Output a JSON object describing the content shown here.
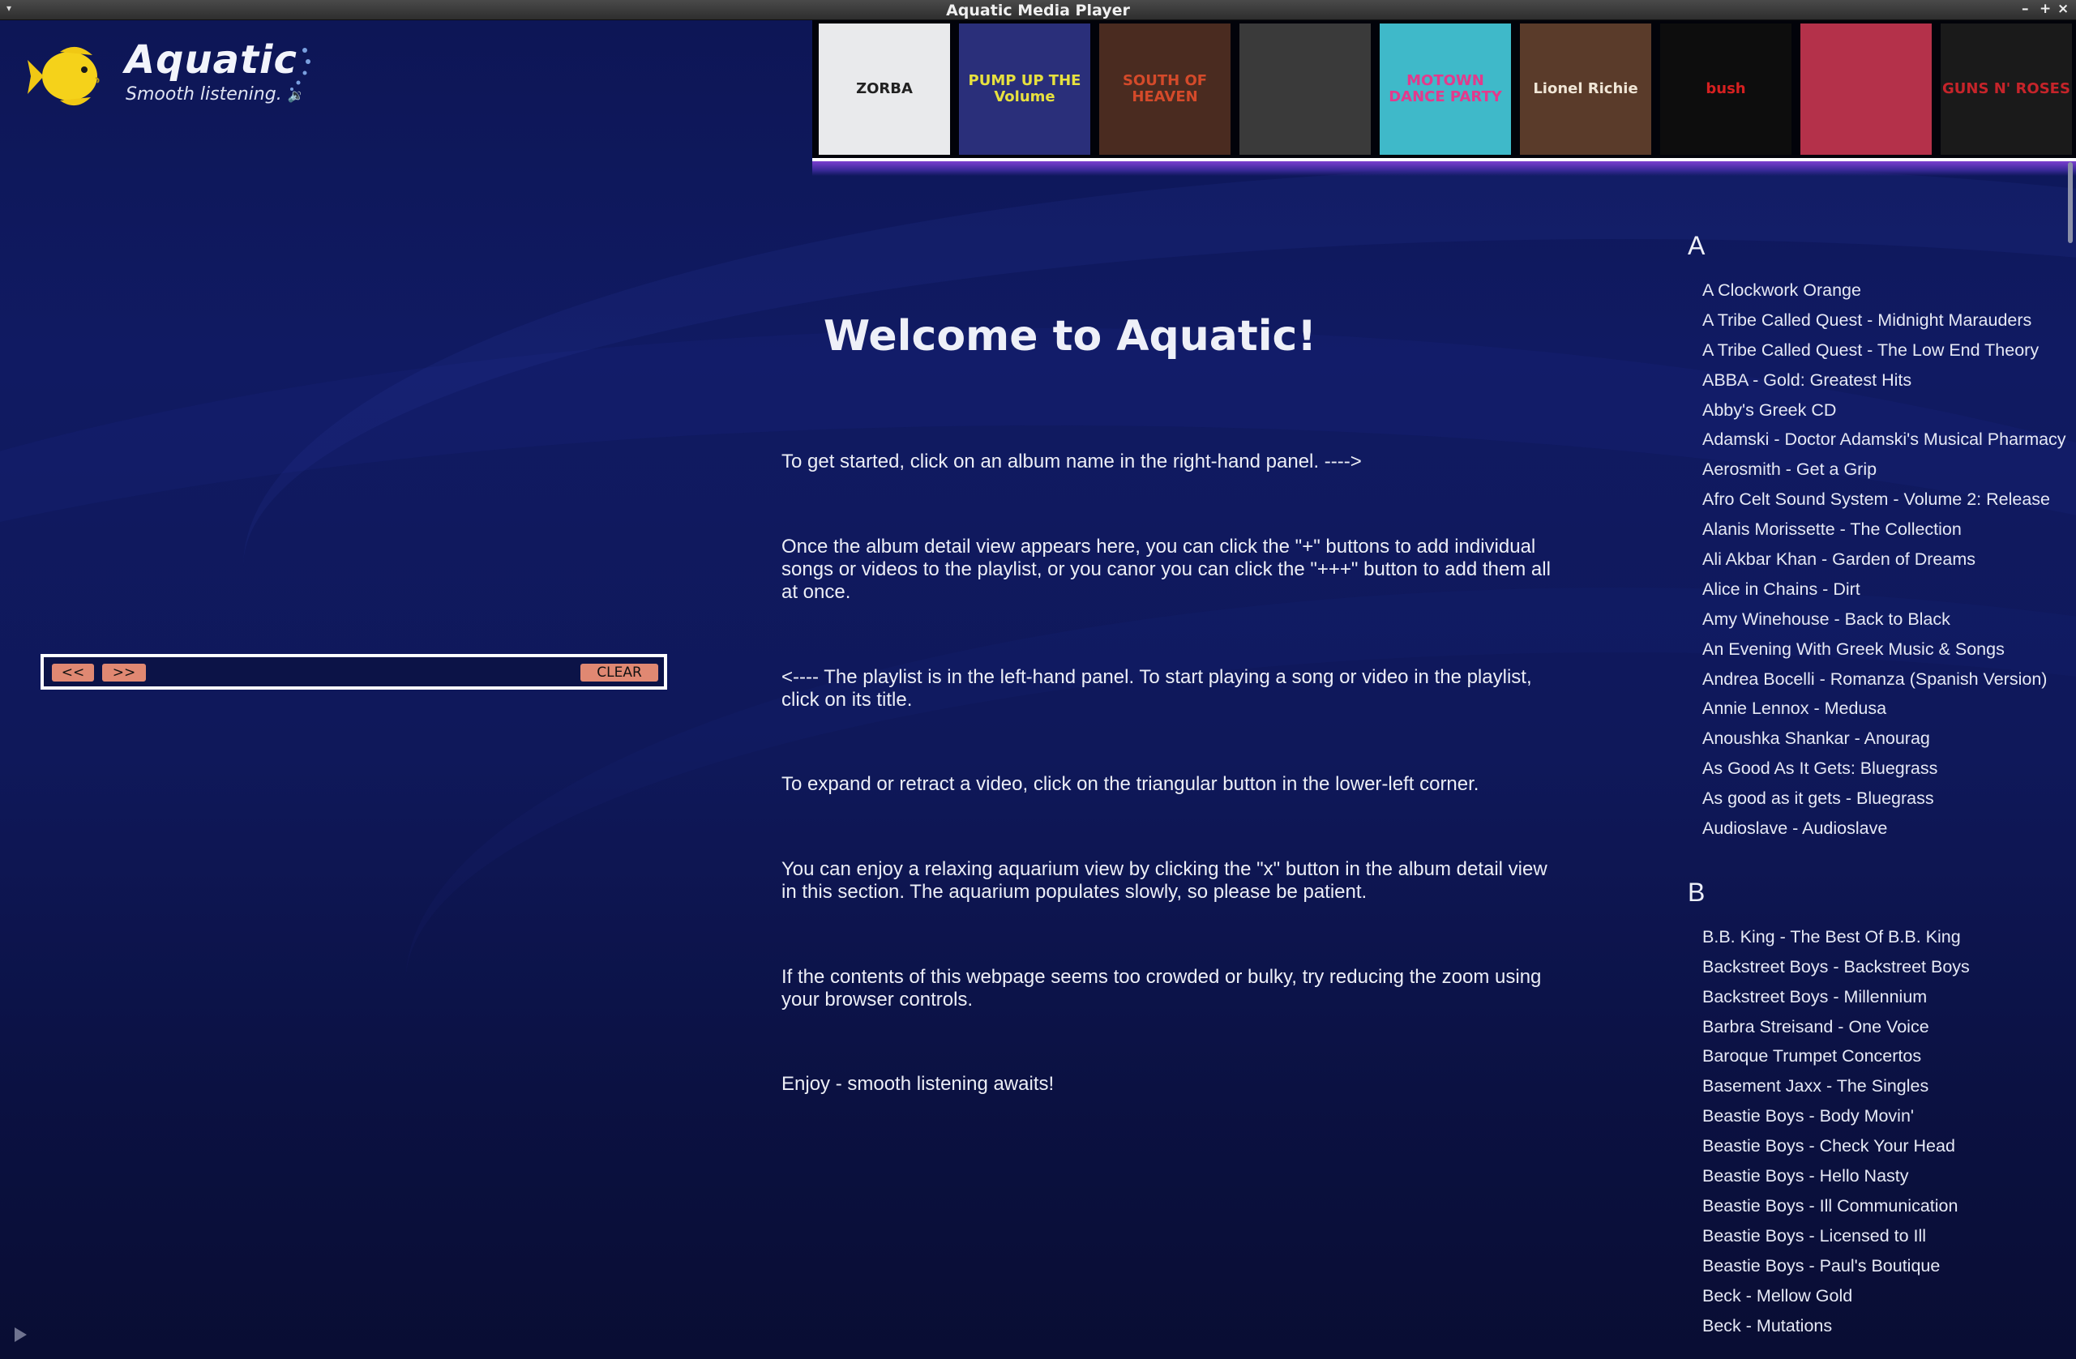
{
  "window": {
    "title": "Aquatic Media Player",
    "controls": {
      "minimize": "–",
      "maximize": "+",
      "close": "×"
    }
  },
  "logo": {
    "app_name": "Aquatic",
    "tagline": "Smooth listening."
  },
  "album_strip": [
    {
      "label": "ZORBA",
      "bg": "#e9eaec",
      "fg": "#222"
    },
    {
      "label": "PUMP UP THE Volume",
      "bg": "#2a2f7a",
      "fg": "#e7e13f"
    },
    {
      "label": "SOUTH OF HEAVEN",
      "bg": "#4a2b20",
      "fg": "#d44a2a"
    },
    {
      "label": "",
      "bg": "#3a3a3a",
      "fg": "#bbb"
    },
    {
      "label": "MOTOWN DANCE PARTY",
      "bg": "#3fb9c9",
      "fg": "#e33a8c"
    },
    {
      "label": "Lionel Richie",
      "bg": "#5a3b2a",
      "fg": "#f0e6d6"
    },
    {
      "label": "bush",
      "bg": "#0d0d0d",
      "fg": "#d62020"
    },
    {
      "label": "",
      "bg": "#b4314a",
      "fg": "#eee"
    },
    {
      "label": "GUNS N' ROSES",
      "bg": "#1a1a1a",
      "fg": "#c6242a"
    }
  ],
  "playlist": {
    "prev_label": "<<",
    "next_label": ">>",
    "clear_label": "CLEAR"
  },
  "main": {
    "title": "Welcome to Aquatic!",
    "paragraphs": [
      "To get started, click on an album name in the right-hand panel.    ---->",
      "Once the album detail view appears here, you can click the \"+\" buttons to add individual songs or videos to the playlist, or you canor you can click the \"+++\" button to add them all at once.",
      "<----    The playlist is in the left-hand panel. To start playing a song or video in the playlist, click on its title.",
      "To expand or retract a video, click on the triangular button in the lower-left corner.",
      "You can enjoy a relaxing aquarium view by clicking the \"x\" button in the album detail view in this section. The aquarium populates slowly, so please be patient.",
      "If the contents of this webpage seems too crowded or bulky, try reducing the zoom using your browser controls.",
      "Enjoy - smooth listening awaits!"
    ]
  },
  "albums": {
    "A": {
      "letter": "A",
      "items": [
        "A Clockwork Orange",
        "A Tribe Called Quest - Midnight Marauders",
        "A Tribe Called Quest - The Low End Theory",
        "ABBA - Gold: Greatest Hits",
        "Abby's Greek CD",
        "Adamski - Doctor Adamski's Musical Pharmacy",
        "Aerosmith - Get a Grip",
        "Afro Celt Sound System - Volume 2: Release",
        "Alanis Morissette - The Collection",
        "Ali Akbar Khan - Garden of Dreams",
        "Alice in Chains - Dirt",
        "Amy Winehouse - Back to Black",
        "An Evening With Greek Music & Songs",
        "Andrea Bocelli - Romanza (Spanish Version)",
        "Annie Lennox - Medusa",
        "Anoushka Shankar - Anourag",
        "As Good As It Gets: Bluegrass",
        "As good as it gets - Bluegrass",
        "Audioslave - Audioslave"
      ]
    },
    "B": {
      "letter": "B",
      "items": [
        "B.B. King - The Best Of B.B. King",
        "Backstreet Boys - Backstreet Boys",
        "Backstreet Boys - Millennium",
        "Barbra Streisand - One Voice",
        "Baroque Trumpet Concertos",
        "Basement Jaxx - The Singles",
        "Beastie Boys - Body Movin'",
        "Beastie Boys - Check Your Head",
        "Beastie Boys - Hello Nasty",
        "Beastie Boys - Ill Communication",
        "Beastie Boys - Licensed to Ill",
        "Beastie Boys - Paul's Boutique",
        "Beck - Mellow Gold",
        "Beck - Mutations"
      ]
    }
  }
}
